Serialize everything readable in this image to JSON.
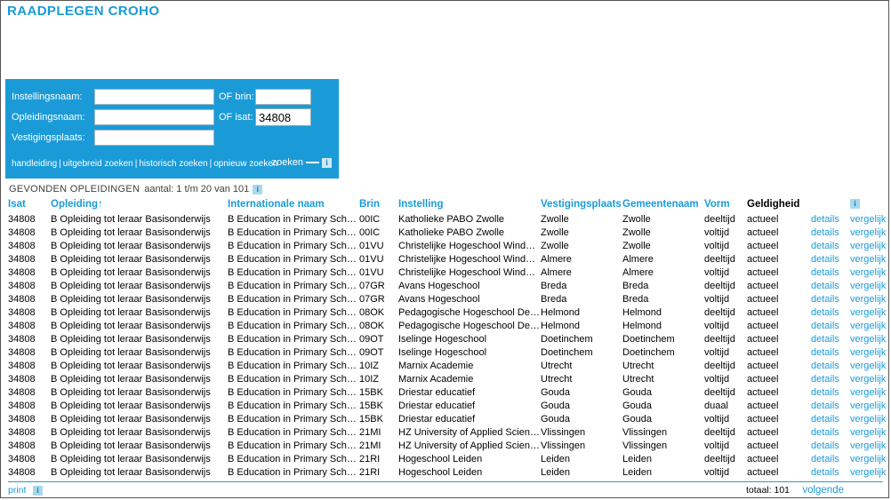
{
  "app": {
    "title": "RAADPLEGEN CROHO"
  },
  "search": {
    "labels": {
      "instellingsnaam": "Instellingsnaam:",
      "of_brin": "OF brin:",
      "opleidingsnaam": "Opleidingsnaam:",
      "of_isat": "OF isat:",
      "vestigingsplaats": "Vestigingsplaats:"
    },
    "values": {
      "instellingsnaam": "",
      "brin": "",
      "opleidingsnaam": "",
      "isat": "34808",
      "vestigingsplaats": ""
    },
    "links": [
      "handleiding",
      "uitgebreid zoeken",
      "historisch zoeken",
      "opnieuw zoeken"
    ],
    "separator": "|",
    "submit_label": "zoeken",
    "info_icon": "i"
  },
  "results": {
    "title": "GEVONDEN OPLEIDINGEN",
    "count_text": "aantal: 1 t/m 20 van 101",
    "info_icon": "i",
    "columns": [
      "Isat",
      "Opleiding↑",
      "Internationale naam",
      "Brin",
      "Instelling",
      "Vestigingsplaats",
      "Gemeentenaam",
      "Vorm",
      "Geldigheid",
      "",
      "i"
    ],
    "details_label": "details",
    "compare_label": "vergelijk",
    "rows": [
      {
        "isat": "34808",
        "opleiding": "B Opleiding tot leraar Basisonderwijs",
        "internationale_naam": "B Education in Primary School...",
        "brin": "00IC",
        "instelling": "Katholieke PABO Zwolle",
        "vestigingsplaats": "Zwolle",
        "gemeentenaam": "Zwolle",
        "vorm": "deeltijd",
        "geldigheid": "actueel"
      },
      {
        "isat": "34808",
        "opleiding": "B Opleiding tot leraar Basisonderwijs",
        "internationale_naam": "B Education in Primary School...",
        "brin": "00IC",
        "instelling": "Katholieke PABO Zwolle",
        "vestigingsplaats": "Zwolle",
        "gemeentenaam": "Zwolle",
        "vorm": "voltijd",
        "geldigheid": "actueel"
      },
      {
        "isat": "34808",
        "opleiding": "B Opleiding tot leraar Basisonderwijs",
        "internationale_naam": "B Education in Primary School...",
        "brin": "01VU",
        "instelling": "Christelijke Hogeschool Windesh...",
        "vestigingsplaats": "Zwolle",
        "gemeentenaam": "Zwolle",
        "vorm": "voltijd",
        "geldigheid": "actueel"
      },
      {
        "isat": "34808",
        "opleiding": "B Opleiding tot leraar Basisonderwijs",
        "internationale_naam": "B Education in Primary School...",
        "brin": "01VU",
        "instelling": "Christelijke Hogeschool Windesh...",
        "vestigingsplaats": "Almere",
        "gemeentenaam": "Almere",
        "vorm": "deeltijd",
        "geldigheid": "actueel"
      },
      {
        "isat": "34808",
        "opleiding": "B Opleiding tot leraar Basisonderwijs",
        "internationale_naam": "B Education in Primary School...",
        "brin": "01VU",
        "instelling": "Christelijke Hogeschool Windesh...",
        "vestigingsplaats": "Almere",
        "gemeentenaam": "Almere",
        "vorm": "voltijd",
        "geldigheid": "actueel"
      },
      {
        "isat": "34808",
        "opleiding": "B Opleiding tot leraar Basisonderwijs",
        "internationale_naam": "B Education in Primary School...",
        "brin": "07GR",
        "instelling": "Avans Hogeschool",
        "vestigingsplaats": "Breda",
        "gemeentenaam": "Breda",
        "vorm": "deeltijd",
        "geldigheid": "actueel"
      },
      {
        "isat": "34808",
        "opleiding": "B Opleiding tot leraar Basisonderwijs",
        "internationale_naam": "B Education in Primary School...",
        "brin": "07GR",
        "instelling": "Avans Hogeschool",
        "vestigingsplaats": "Breda",
        "gemeentenaam": "Breda",
        "vorm": "voltijd",
        "geldigheid": "actueel"
      },
      {
        "isat": "34808",
        "opleiding": "B Opleiding tot leraar Basisonderwijs",
        "internationale_naam": "B Education in Primary School...",
        "brin": "08OK",
        "instelling": "Pedagogische Hogeschool De Ke...",
        "vestigingsplaats": "Helmond",
        "gemeentenaam": "Helmond",
        "vorm": "deeltijd",
        "geldigheid": "actueel"
      },
      {
        "isat": "34808",
        "opleiding": "B Opleiding tot leraar Basisonderwijs",
        "internationale_naam": "B Education in Primary School...",
        "brin": "08OK",
        "instelling": "Pedagogische Hogeschool De Ke...",
        "vestigingsplaats": "Helmond",
        "gemeentenaam": "Helmond",
        "vorm": "voltijd",
        "geldigheid": "actueel"
      },
      {
        "isat": "34808",
        "opleiding": "B Opleiding tot leraar Basisonderwijs",
        "internationale_naam": "B Education in Primary School...",
        "brin": "09OT",
        "instelling": "Iselinge Hogeschool",
        "vestigingsplaats": "Doetinchem",
        "gemeentenaam": "Doetinchem",
        "vorm": "deeltijd",
        "geldigheid": "actueel"
      },
      {
        "isat": "34808",
        "opleiding": "B Opleiding tot leraar Basisonderwijs",
        "internationale_naam": "B Education in Primary School...",
        "brin": "09OT",
        "instelling": "Iselinge Hogeschool",
        "vestigingsplaats": "Doetinchem",
        "gemeentenaam": "Doetinchem",
        "vorm": "voltijd",
        "geldigheid": "actueel"
      },
      {
        "isat": "34808",
        "opleiding": "B Opleiding tot leraar Basisonderwijs",
        "internationale_naam": "B Education in Primary School...",
        "brin": "10IZ",
        "instelling": "Marnix Academie",
        "vestigingsplaats": "Utrecht",
        "gemeentenaam": "Utrecht",
        "vorm": "deeltijd",
        "geldigheid": "actueel"
      },
      {
        "isat": "34808",
        "opleiding": "B Opleiding tot leraar Basisonderwijs",
        "internationale_naam": "B Education in Primary School...",
        "brin": "10IZ",
        "instelling": "Marnix Academie",
        "vestigingsplaats": "Utrecht",
        "gemeentenaam": "Utrecht",
        "vorm": "voltijd",
        "geldigheid": "actueel"
      },
      {
        "isat": "34808",
        "opleiding": "B Opleiding tot leraar Basisonderwijs",
        "internationale_naam": "B Education in Primary School...",
        "brin": "15BK",
        "instelling": "Driestar educatief",
        "vestigingsplaats": "Gouda",
        "gemeentenaam": "Gouda",
        "vorm": "deeltijd",
        "geldigheid": "actueel"
      },
      {
        "isat": "34808",
        "opleiding": "B Opleiding tot leraar Basisonderwijs",
        "internationale_naam": "B Education in Primary School...",
        "brin": "15BK",
        "instelling": "Driestar educatief",
        "vestigingsplaats": "Gouda",
        "gemeentenaam": "Gouda",
        "vorm": "duaal",
        "geldigheid": "actueel"
      },
      {
        "isat": "34808",
        "opleiding": "B Opleiding tot leraar Basisonderwijs",
        "internationale_naam": "B Education in Primary School...",
        "brin": "15BK",
        "instelling": "Driestar educatief",
        "vestigingsplaats": "Gouda",
        "gemeentenaam": "Gouda",
        "vorm": "voltijd",
        "geldigheid": "actueel"
      },
      {
        "isat": "34808",
        "opleiding": "B Opleiding tot leraar Basisonderwijs",
        "internationale_naam": "B Education in Primary School...",
        "brin": "21MI",
        "instelling": "HZ University of Applied Sciences",
        "vestigingsplaats": "Vlissingen",
        "gemeentenaam": "Vlissingen",
        "vorm": "deeltijd",
        "geldigheid": "actueel"
      },
      {
        "isat": "34808",
        "opleiding": "B Opleiding tot leraar Basisonderwijs",
        "internationale_naam": "B Education in Primary School...",
        "brin": "21MI",
        "instelling": "HZ University of Applied Sciences",
        "vestigingsplaats": "Vlissingen",
        "gemeentenaam": "Vlissingen",
        "vorm": "voltijd",
        "geldigheid": "actueel"
      },
      {
        "isat": "34808",
        "opleiding": "B Opleiding tot leraar Basisonderwijs",
        "internationale_naam": "B Education in Primary School...",
        "brin": "21RI",
        "instelling": "Hogeschool Leiden",
        "vestigingsplaats": "Leiden",
        "gemeentenaam": "Leiden",
        "vorm": "deeltijd",
        "geldigheid": "actueel"
      },
      {
        "isat": "34808",
        "opleiding": "B Opleiding tot leraar Basisonderwijs",
        "internationale_naam": "B Education in Primary School...",
        "brin": "21RI",
        "instelling": "Hogeschool Leiden",
        "vestigingsplaats": "Leiden",
        "gemeentenaam": "Leiden",
        "vorm": "voltijd",
        "geldigheid": "actueel"
      }
    ]
  },
  "footer": {
    "print_label": "print",
    "info_icon": "i",
    "total_text": "totaal: 101",
    "next_label": "volgende"
  },
  "colors": {
    "accent": "#1a9bd7",
    "panel": "#1a9bd7",
    "rule": "#2a9ec4",
    "text": "#000000"
  }
}
